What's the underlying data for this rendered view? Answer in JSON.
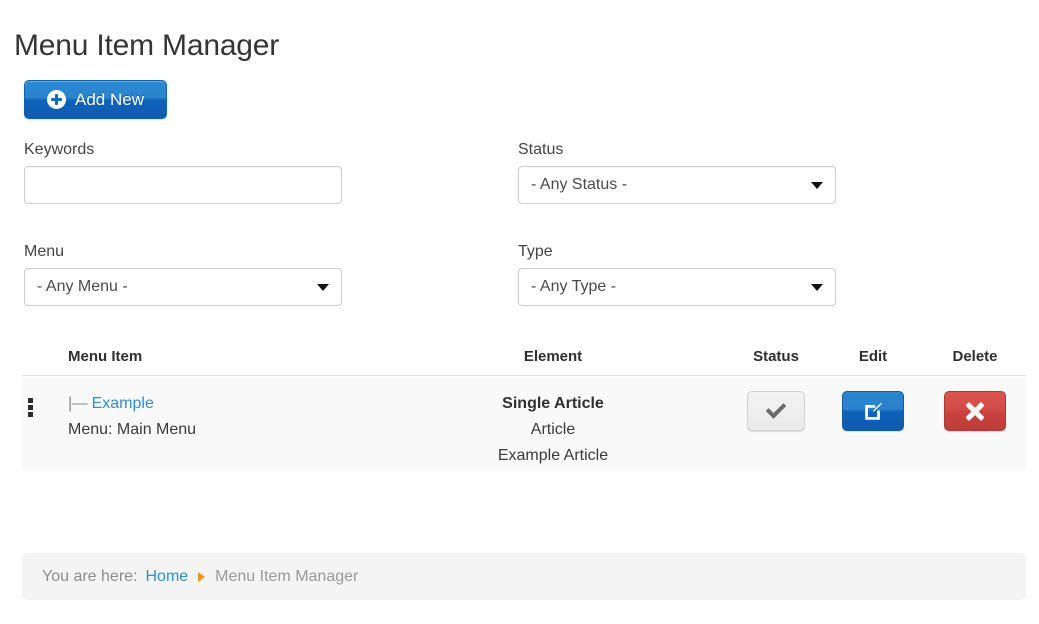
{
  "header": {
    "title": "Menu Item Manager"
  },
  "toolbar": {
    "add_new_label": "Add New",
    "add_new_icon": "plus-circle-icon",
    "add_new_color": "#0f62ba"
  },
  "filters": {
    "keywords": {
      "label": "Keywords",
      "value": "",
      "placeholder": ""
    },
    "menu": {
      "label": "Menu",
      "selected": "- Any Menu -"
    },
    "status": {
      "label": "Status",
      "selected": "- Any Status -"
    },
    "type": {
      "label": "Type",
      "selected": "- Any Type -"
    }
  },
  "table": {
    "columns": {
      "menu_item": "Menu Item",
      "element": "Element",
      "status": "Status",
      "edit": "Edit",
      "delete": "Delete"
    },
    "rows": [
      {
        "drag_handle_icon": "grip-vertical-icon",
        "tree_prefix": "|—",
        "title": "Example",
        "subtitle": "Menu: Main Menu",
        "element_main": "Single Article",
        "element_type": "Article",
        "element_name": "Example Article",
        "status_icon": "check-icon",
        "status_button_color": "#e9e9e9",
        "edit_icon": "pencil-square-icon",
        "edit_button_color": "#0f62ba",
        "delete_icon": "x-icon",
        "delete_button_color": "#c9433f"
      }
    ]
  },
  "breadcrumb": {
    "prefix": "You are here:",
    "home": "Home",
    "separator_icon": "triangle-right-icon",
    "separator_color": "#f0921e",
    "current": "Menu Item Manager"
  }
}
